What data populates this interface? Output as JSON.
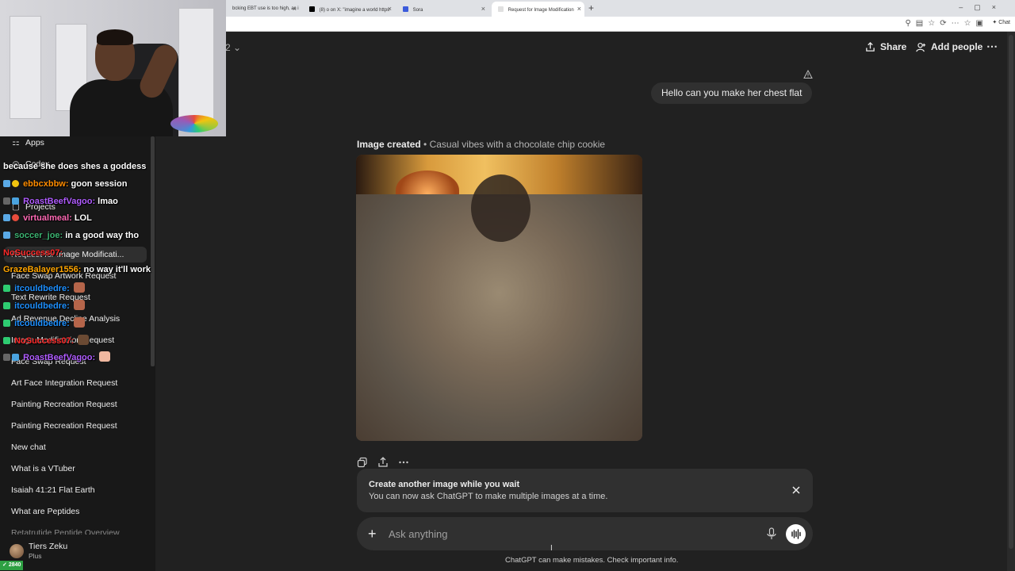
{
  "browser": {
    "tabs": [
      {
        "title": "bcking EBT use is too high, as i",
        "favicon_color": "#e0e0e0"
      },
      {
        "title": "(8) o on X: \"imagine a world https",
        "favicon_color": "#000000"
      },
      {
        "title": "Sora",
        "favicon_color": "#3b5bdb"
      },
      {
        "title": "Request for Image Modification",
        "favicon_color": "#e0e0e0"
      }
    ],
    "new_tab": "+",
    "chat_pill": "Chat"
  },
  "header": {
    "model_chevron": "2 ⌄",
    "share_label": "Share",
    "add_people_label": "Add people"
  },
  "conversation": {
    "user_message": "Hello can you make her chest flat",
    "image_caption_title": "Image created",
    "image_caption_sub": "Casual vibes with a chocolate chip cookie",
    "separator": " • "
  },
  "notice": {
    "title": "Create another image while you wait",
    "description": "You can now ask ChatGPT to make multiple images at a time."
  },
  "composer": {
    "placeholder": "Ask anything"
  },
  "disclaimer": "ChatGPT can make mistakes. Check important info.",
  "sidebar": {
    "nav": [
      {
        "label": "Apps",
        "icon": "apps-icon",
        "glyph": "⚏"
      },
      {
        "label": "Codex",
        "icon": "codex-icon",
        "glyph": "◎"
      },
      {
        "label": "Projects",
        "icon": "projects-icon",
        "glyph": "▢"
      }
    ],
    "chats": [
      "Request for Image Modificati...",
      "Face Swap Artwork Request",
      "Text Rewrite Request",
      "Ad Revenue Decline Analysis",
      "Image Modification Request",
      "Face Swap Request",
      "Art Face Integration Request",
      "Painting Recreation Request",
      "Painting Recreation Request",
      "New chat",
      "What is a VTuber",
      "Isaiah 41:21 Flat Earth",
      "What are Peptides",
      "Retatrutide Peptide Overview"
    ],
    "user_name": "Tiers Zeku",
    "user_plan": "Plus"
  },
  "stream_chat": [
    {
      "user": "",
      "message": "because she does shes a goddess",
      "color": "#ffffff"
    },
    {
      "user": "ebbcxbbw:",
      "message": "goon session",
      "color": "#ff8c00"
    },
    {
      "user": "RoastBeefVagoo:",
      "message": "lmao",
      "color": "#b05cff"
    },
    {
      "user": "virtualmeal:",
      "message": "LOL",
      "color": "#ff69b4"
    },
    {
      "user": "soccer_joe:",
      "message": "in a good way tho",
      "color": "#3cb371"
    },
    {
      "user": "NoSuccess07:",
      "message": "",
      "color": "#ff2a2a"
    },
    {
      "user": "GrazeBalayer1556:",
      "message": "no way it'll work",
      "color": "#ffa500"
    },
    {
      "user": "itcouldbedre:",
      "message": "",
      "color": "#1e90ff"
    },
    {
      "user": "itcouldbedre:",
      "message": "",
      "color": "#1e90ff"
    },
    {
      "user": "itcouldbedre:",
      "message": "",
      "color": "#1e90ff"
    },
    {
      "user": "NoSuccess07:",
      "message": "",
      "color": "#ff2a2a"
    },
    {
      "user": "RoastBeefVagoo:",
      "message": "",
      "color": "#b05cff"
    }
  ],
  "viewer_count": "2840"
}
